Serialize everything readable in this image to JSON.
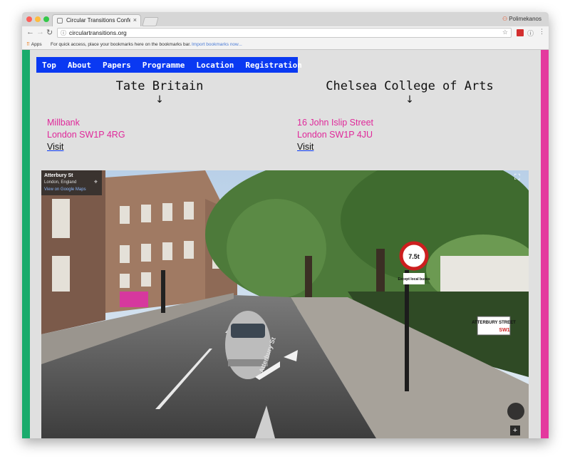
{
  "browser": {
    "tab_title": "Circular Transitions Conferenc",
    "tab_close": "×",
    "profile_name": "Polimekanos",
    "url": "circulartransitions.org",
    "apps_label": "Apps",
    "bookmarks_hint": "For quick access, place your bookmarks here on the bookmarks bar.",
    "import_link": "Import bookmarks now..."
  },
  "nav": {
    "items": [
      "Top",
      "About",
      "Papers",
      "Programme",
      "Location",
      "Registration"
    ]
  },
  "venues": [
    {
      "name": "Tate Britain",
      "arrow": "↓",
      "street": "Millbank",
      "city": "London SW1P 4RG",
      "link": "Visit"
    },
    {
      "name": "Chelsea College of Arts",
      "arrow": "↓",
      "street": "16 John Islip Street",
      "city": "London SW1P 4JU",
      "link": "Visit"
    }
  ],
  "streetview": {
    "street": "Atterbury St",
    "area": "London, England",
    "link": "View on Google Maps",
    "sign_street": "ATTERBURY STREET",
    "sign_district": "SW1",
    "sign_except": "Except local buses",
    "sign_weight": "7.5t",
    "road_label": "Atterbury St"
  },
  "colors": {
    "nav_bg": "#0a39f2",
    "accent_pink": "#e0289a",
    "stripe_green": "#1aab6c",
    "stripe_pink": "#e4399e"
  }
}
